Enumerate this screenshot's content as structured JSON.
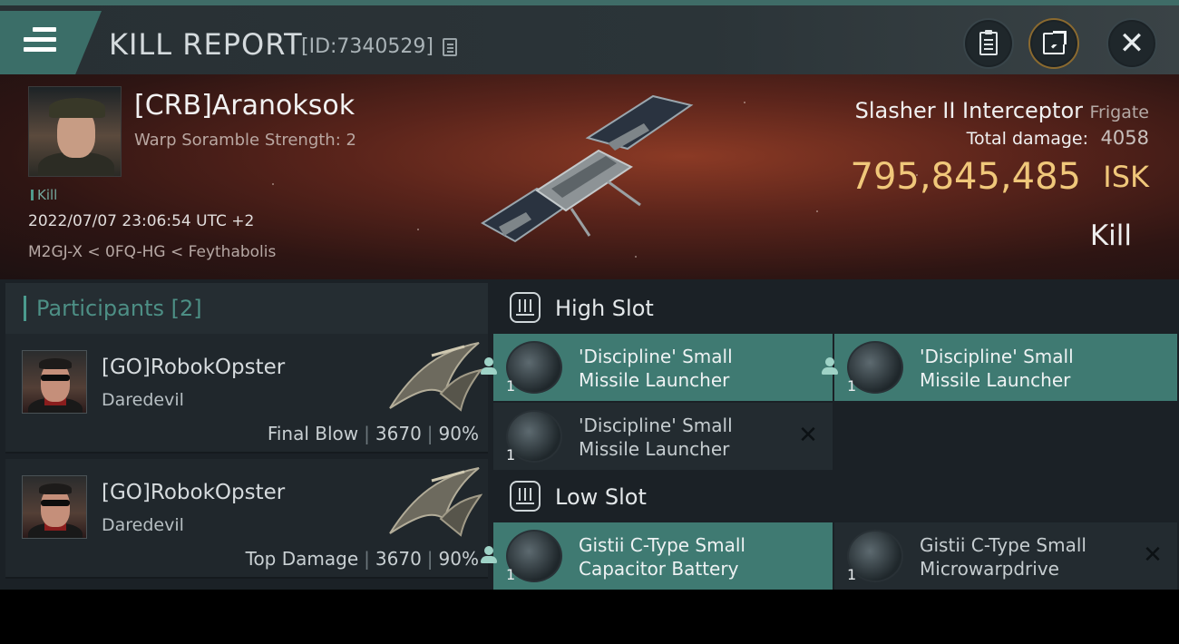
{
  "header": {
    "title": "KILL REPORT",
    "report_id": "[ID:7340529]"
  },
  "victim": {
    "name": "[CRB]Aranoksok",
    "subtitle": "Warp Soramble Strength: 2",
    "tag": "Kill",
    "timestamp": "2022/07/07 23:06:54 UTC +2",
    "location": "M2GJ-X < 0FQ-HG < Feythabolis"
  },
  "ship": {
    "name": "Slasher II Interceptor",
    "class": "Frigate",
    "damage_label": "Total damage:",
    "damage_value": "4058",
    "isk_value": "795,845,485",
    "isk_unit": "ISK",
    "result": "Kill"
  },
  "participants": {
    "title": "Participants [2]",
    "items": [
      {
        "name": "[GO]RobokOpster",
        "ship": "Daredevil",
        "role": "Final Blow",
        "damage": "3670",
        "percent": "90%"
      },
      {
        "name": "[GO]RobokOpster",
        "ship": "Daredevil",
        "role": "Top Damage",
        "damage": "3670",
        "percent": "90%"
      }
    ]
  },
  "slots": {
    "high": {
      "title": "High Slot",
      "modules": [
        {
          "name": "'Discipline' Small Missile Launcher",
          "qty": "1",
          "state": "fitted"
        },
        {
          "name": "'Discipline' Small Missile Launcher",
          "qty": "1",
          "state": "fitted"
        },
        {
          "name": "'Discipline' Small Missile Launcher",
          "qty": "1",
          "state": "destroyed"
        }
      ]
    },
    "low": {
      "title": "Low Slot",
      "modules": [
        {
          "name": "Gistii C-Type Small Capacitor Battery",
          "qty": "1",
          "state": "fitted"
        },
        {
          "name": "Gistii C-Type Small Microwarpdrive",
          "qty": "1",
          "state": "destroyed"
        }
      ]
    }
  },
  "icons": {
    "menu": "menu-icon",
    "copy": "copy-icon",
    "notes": "clipboard-icon",
    "share": "share-icon",
    "close": "close-icon",
    "slot": "slot-icon",
    "fitted": "person-icon",
    "destroyed": "x-icon"
  },
  "colors": {
    "accent": "#3f7a72",
    "isk": "#f0c77a",
    "participants_title": "#4d8f85"
  }
}
